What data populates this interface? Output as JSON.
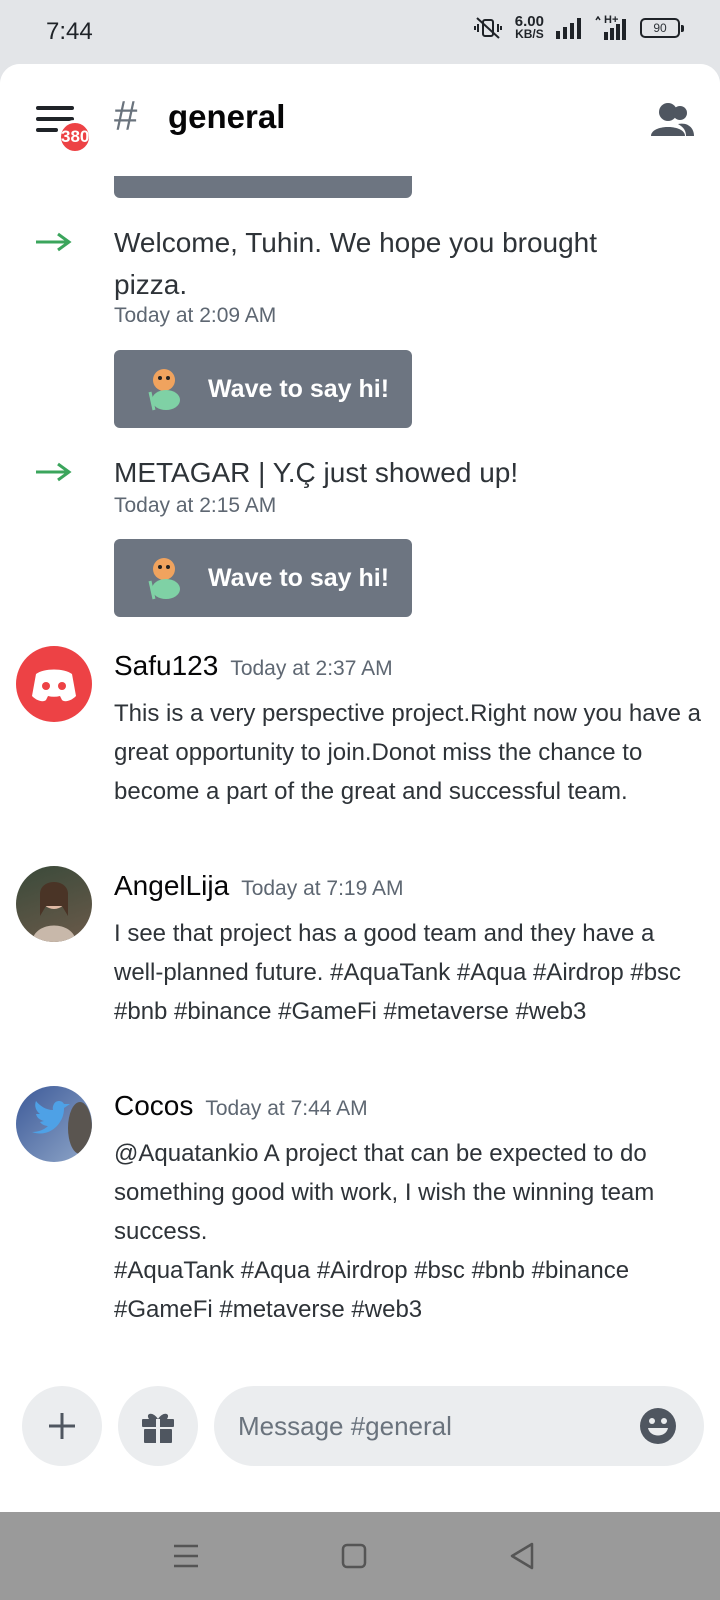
{
  "status_bar": {
    "time": "7:44",
    "net_speed_value": "6.00",
    "net_speed_unit": "KB/S",
    "network_type": "H+",
    "battery": "90"
  },
  "header": {
    "menu_badge": "380",
    "channel_hash": "#",
    "channel_name": "general"
  },
  "system_messages": [
    {
      "text": "Welcome, Tuhin. We hope you brought pizza.",
      "time": "Today at 2:09 AM",
      "wave_label": "Wave to say hi!"
    },
    {
      "text": "METAGAR | Y.Ç just showed up!",
      "time": "Today at 2:15 AM",
      "wave_label": "Wave to say hi!"
    }
  ],
  "messages": [
    {
      "author": "Safu123",
      "time": "Today at 2:37 AM",
      "body": "This is a very perspective project.Right now you have a great opportunity to join.Donot miss the chance to become a part of the great and successful team."
    },
    {
      "author": "AngelLija",
      "time": "Today at 7:19 AM",
      "body": "I see that project has a good team and they have a well-planned future. #AquaTank #Aqua #Airdrop #bsc #bnb #binance #GameFi #metaverse #web3"
    },
    {
      "author": "Cocos",
      "time": "Today at 7:44 AM",
      "body": "@Aquatankio A project that can be expected to do something good with work, I wish the winning team success.",
      "body_tags": "#AquaTank #Aqua #Airdrop #bsc #bnb #binance #GameFi #metaverse #web3"
    }
  ],
  "composer": {
    "placeholder": "Message #general"
  },
  "colors": {
    "accent_green": "#3ba55c",
    "badge_red": "#ed4245",
    "wave_button": "#6d7581"
  }
}
